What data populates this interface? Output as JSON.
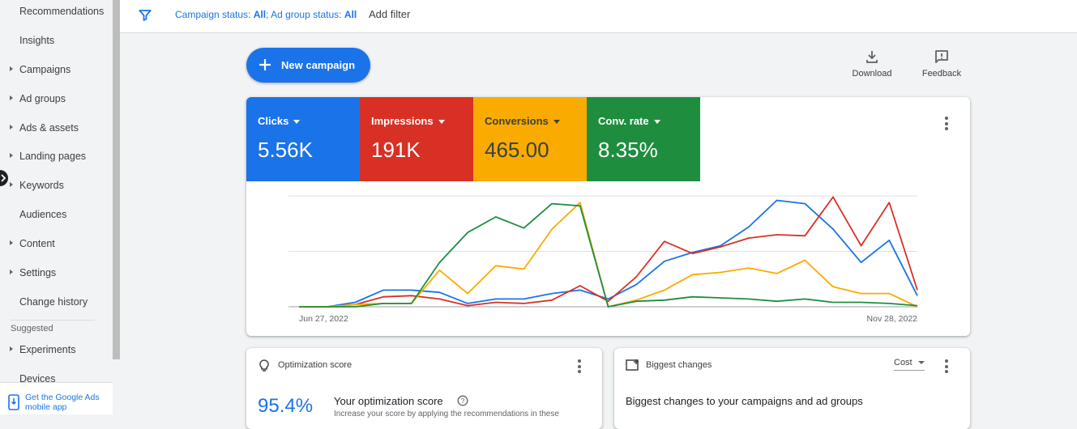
{
  "sidebar": {
    "items": [
      {
        "label": "Recommendations",
        "expandable": false
      },
      {
        "label": "Insights",
        "expandable": false
      },
      {
        "label": "Campaigns",
        "expandable": true
      },
      {
        "label": "Ad groups",
        "expandable": true
      },
      {
        "label": "Ads & assets",
        "expandable": true
      },
      {
        "label": "Landing pages",
        "expandable": true
      },
      {
        "label": "Keywords",
        "expandable": true
      },
      {
        "label": "Audiences",
        "expandable": false
      },
      {
        "label": "Content",
        "expandable": true
      },
      {
        "label": "Settings",
        "expandable": true
      },
      {
        "label": "Change history",
        "expandable": false
      }
    ],
    "suggested_label": "Suggested",
    "suggested_items": [
      {
        "label": "Experiments",
        "expandable": true
      },
      {
        "label": "Devices",
        "expandable": false
      }
    ],
    "mobile_app_label": "Get the Google Ads mobile app"
  },
  "topbar": {
    "campaign_status_label": "Campaign status: ",
    "campaign_status_value": "All",
    "separator": "; ",
    "ad_group_status_label": "Ad group status: ",
    "ad_group_status_value": "All",
    "add_filter": "Add filter"
  },
  "toolbar": {
    "new_campaign": "New campaign",
    "download": "Download",
    "feedback": "Feedback"
  },
  "metrics": [
    {
      "label": "Clicks",
      "value": "5.56K",
      "color": "#1a73e8",
      "text_color": "#ffffff"
    },
    {
      "label": "Impressions",
      "value": "191K",
      "color": "#d93025",
      "text_color": "#ffffff"
    },
    {
      "label": "Conversions",
      "value": "465.00",
      "color": "#f9ab00",
      "text_color": "#3c4043"
    },
    {
      "label": "Conv. rate",
      "value": "8.35%",
      "color": "#1e8e3e",
      "text_color": "#ffffff"
    }
  ],
  "chart_data": {
    "type": "line",
    "x_start_label": "Jun 27, 2022",
    "x_end_label": "Nov 28, 2022",
    "ylim": [
      0,
      100
    ],
    "grid": true,
    "series": [
      {
        "metric": "Clicks",
        "color": "#1a73e8",
        "values": [
          0,
          0,
          4,
          15,
          15,
          13,
          3,
          7,
          7,
          12,
          15,
          7,
          20,
          41,
          49,
          55,
          72,
          96,
          93,
          70,
          40,
          60,
          10
        ]
      },
      {
        "metric": "Impressions",
        "color": "#d93025",
        "values": [
          0,
          0,
          2,
          9,
          10,
          7,
          1,
          4,
          3,
          6,
          19,
          5,
          27,
          59,
          48,
          54,
          62,
          65,
          64,
          99,
          55,
          94,
          15
        ]
      },
      {
        "metric": "Conversions",
        "color": "#f9ab00",
        "values": [
          0,
          0,
          2,
          3,
          3,
          33,
          12,
          37,
          34,
          70,
          94,
          0,
          6,
          15,
          29,
          31,
          35,
          30,
          42,
          18,
          12,
          12,
          0
        ]
      },
      {
        "metric": "Conv. rate",
        "color": "#1e8e3e",
        "values": [
          0,
          0,
          0,
          3,
          3,
          40,
          67,
          81,
          71,
          93,
          91,
          0,
          5,
          6,
          9,
          8,
          7,
          5,
          7,
          4,
          4,
          3,
          1
        ]
      }
    ]
  },
  "optimization": {
    "title": "Optimization score",
    "score": "95.4%",
    "heading": "Your optimization score",
    "desc": "Increase your score by applying the recommendations in these"
  },
  "biggest_changes": {
    "title": "Biggest changes",
    "sort": "Cost",
    "heading": "Biggest changes to your campaigns and ad groups"
  }
}
